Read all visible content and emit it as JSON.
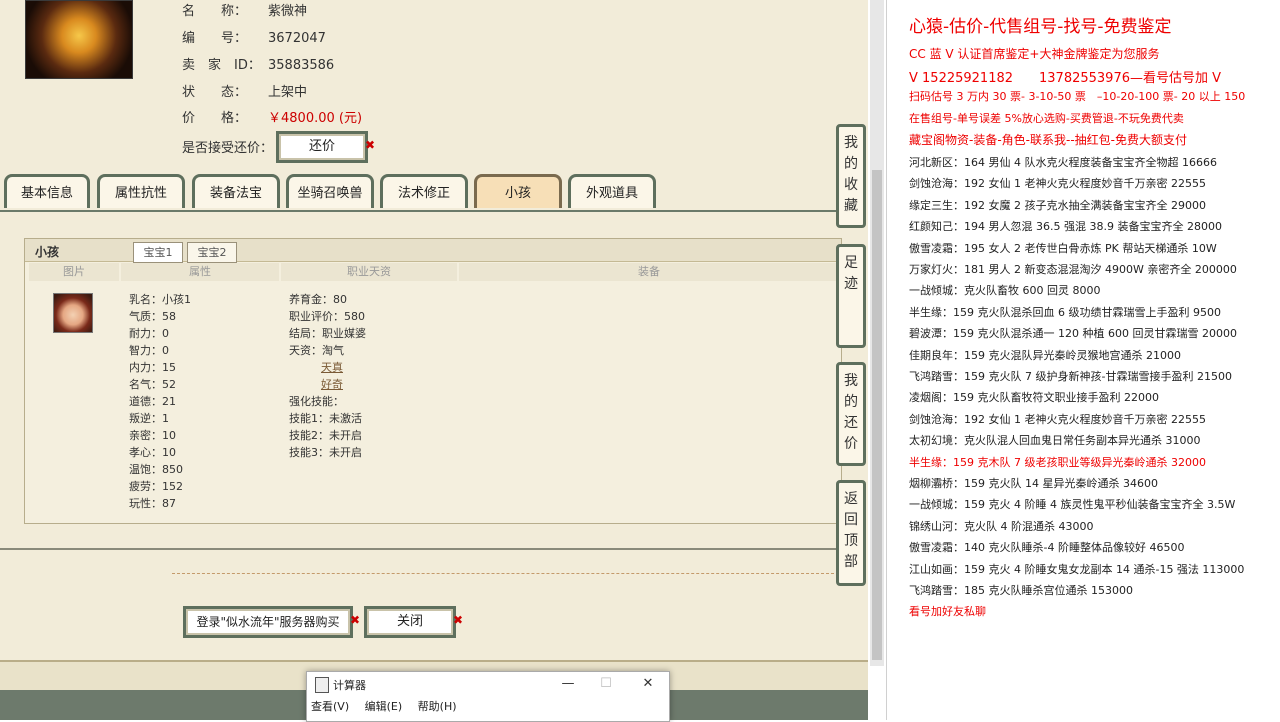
{
  "info": {
    "name_label": "名　　称：",
    "name_value": "紫微神",
    "id_label": "编　　号：",
    "id_value": "3672047",
    "seller_label": "卖　家　ID：",
    "seller_value": "35883586",
    "status_label": "状　　态：",
    "status_value": "上架中",
    "price_label": "价　　格：",
    "price_value": "￥4800.00 (元)",
    "counter_label": "是否接受还价：",
    "counter_button": "还价"
  },
  "tabs": [
    "基本信息",
    "属性抗性",
    "装备法宝",
    "坐骑召唤兽",
    "法术修正",
    "小孩",
    "外观道具"
  ],
  "child_panel": {
    "title": "小孩",
    "subtabs": [
      "宝宝1",
      "宝宝2"
    ],
    "columns": [
      "图片",
      "属性",
      "职业天资",
      "装备"
    ],
    "stats_left": [
      "乳名：小孩1",
      "气质：58",
      "耐力：0",
      "智力：0",
      "内力：15",
      "名气：52",
      "道德：21",
      "叛逆：1",
      "亲密：10",
      "孝心：10",
      "温饱：850",
      "疲劳：152",
      "玩性：87"
    ],
    "stats_right_a": [
      "养育金：80",
      "职业评价：580",
      "结局：职业媒婆",
      "天资：淘气"
    ],
    "talents": [
      "天真",
      "好奇"
    ],
    "stats_right_b": [
      "强化技能：",
      "技能1：未激活",
      "技能2：未开启",
      "技能3：未开启"
    ]
  },
  "sidebar": [
    "我的收藏",
    "足迹",
    "我的还价",
    "返回顶部"
  ],
  "bottom_buttons": {
    "login": "登录\"似水流年\"服务器购买",
    "close": "关闭"
  },
  "calculator": {
    "title": "计算器",
    "menu": [
      "查看(V)",
      "编辑(E)",
      "帮助(H)"
    ],
    "min": "—",
    "max": "☐",
    "close": "✕"
  },
  "doc": {
    "headline": "心猿-估价-代售组号-找号-免费鉴定",
    "lines_red": [
      "CC 蓝 V 认证首席鉴定+大神金牌鉴定为您服务",
      "V 15225921182　　13782553976—看号估号加 V",
      "扫码估号 3 万内 30 票- 3-10-50 票　–10-20-100 票- 20 以上 150",
      "在售组号-单号误差 5%放心选购-买费管退-不玩免费代卖",
      "藏宝阁物资-装备-角色-联系我--抽红包-免费大额支付"
    ],
    "lines": [
      {
        "t": "河北新区：164 男仙 4 队水克火程度装备宝宝齐全物超 16666",
        "red": false
      },
      {
        "t": "剑蚀沧海：192 女仙 1 老神火克火程度妙音千万亲密 22555",
        "red": false
      },
      {
        "t": "缘定三生：192 女魔 2 孩子克水抽全满装备宝宝齐全 29000",
        "red": false
      },
      {
        "t": "红颜知己：194 男人忽混 36.5 强混 38.9 装备宝宝齐全 28000",
        "red": false
      },
      {
        "t": "傲雪凌霜：195 女人 2 老传世白骨赤炼 PK 帮站天梯通杀 10W",
        "red": false
      },
      {
        "t": "万家灯火：181 男人 2 新变态混混淘汐 4900W 亲密齐全 200000",
        "red": false
      },
      {
        "t": "一战倾城：克火队畜牧 600 回灵 8000",
        "red": false
      },
      {
        "t": "半生缘：159 克火队混杀回血 6 级功绩甘霖瑞雪上手盈利 9500",
        "red": false
      },
      {
        "t": "碧波潭：159 克火队混杀通一 120 种植 600 回灵甘霖瑞雪 20000",
        "red": false
      },
      {
        "t": "佳期良年：159 克火混队异光秦岭灵猴地宫通杀 21000",
        "red": false
      },
      {
        "t": "飞鸿踏雪：159 克火队 7 级护身新神孩-甘霖瑞雪接手盈利 21500",
        "red": false
      },
      {
        "t": "凌烟阁：159 克火队畜牧符文职业接手盈利 22000",
        "red": false
      },
      {
        "t": "剑蚀沧海：192 女仙 1 老神火克火程度妙音千万亲密 22555",
        "red": false
      },
      {
        "t": "太初幻境：克火队混人回血鬼日常任务副本异光通杀 31000",
        "red": false
      },
      {
        "t": "半生缘：159 克木队 7 级老孩职业等级异光秦岭通杀 32000",
        "red": true
      },
      {
        "t": "烟柳灞桥：159 克火队 14 星异光秦岭通杀 34600",
        "red": false
      },
      {
        "t": "一战倾城：159 克火 4 阶睡 4 族灵性鬼平秒仙装备宝宝齐全 3.5W",
        "red": false
      },
      {
        "t": "锦绣山河：克火队 4 阶混通杀 43000",
        "red": false
      },
      {
        "t": "傲雪凌霜：140 克火队睡杀-4 阶睡整体品像较好 46500",
        "red": false
      },
      {
        "t": "江山如画：159 克火 4 阶睡女鬼女龙副本 14 通杀-15 强法 113000",
        "red": false
      },
      {
        "t": "飞鸿踏雪：185 克火队睡杀宫位通杀 153000",
        "red": false
      },
      {
        "t": "看号加好友私聊",
        "red": true
      }
    ]
  }
}
